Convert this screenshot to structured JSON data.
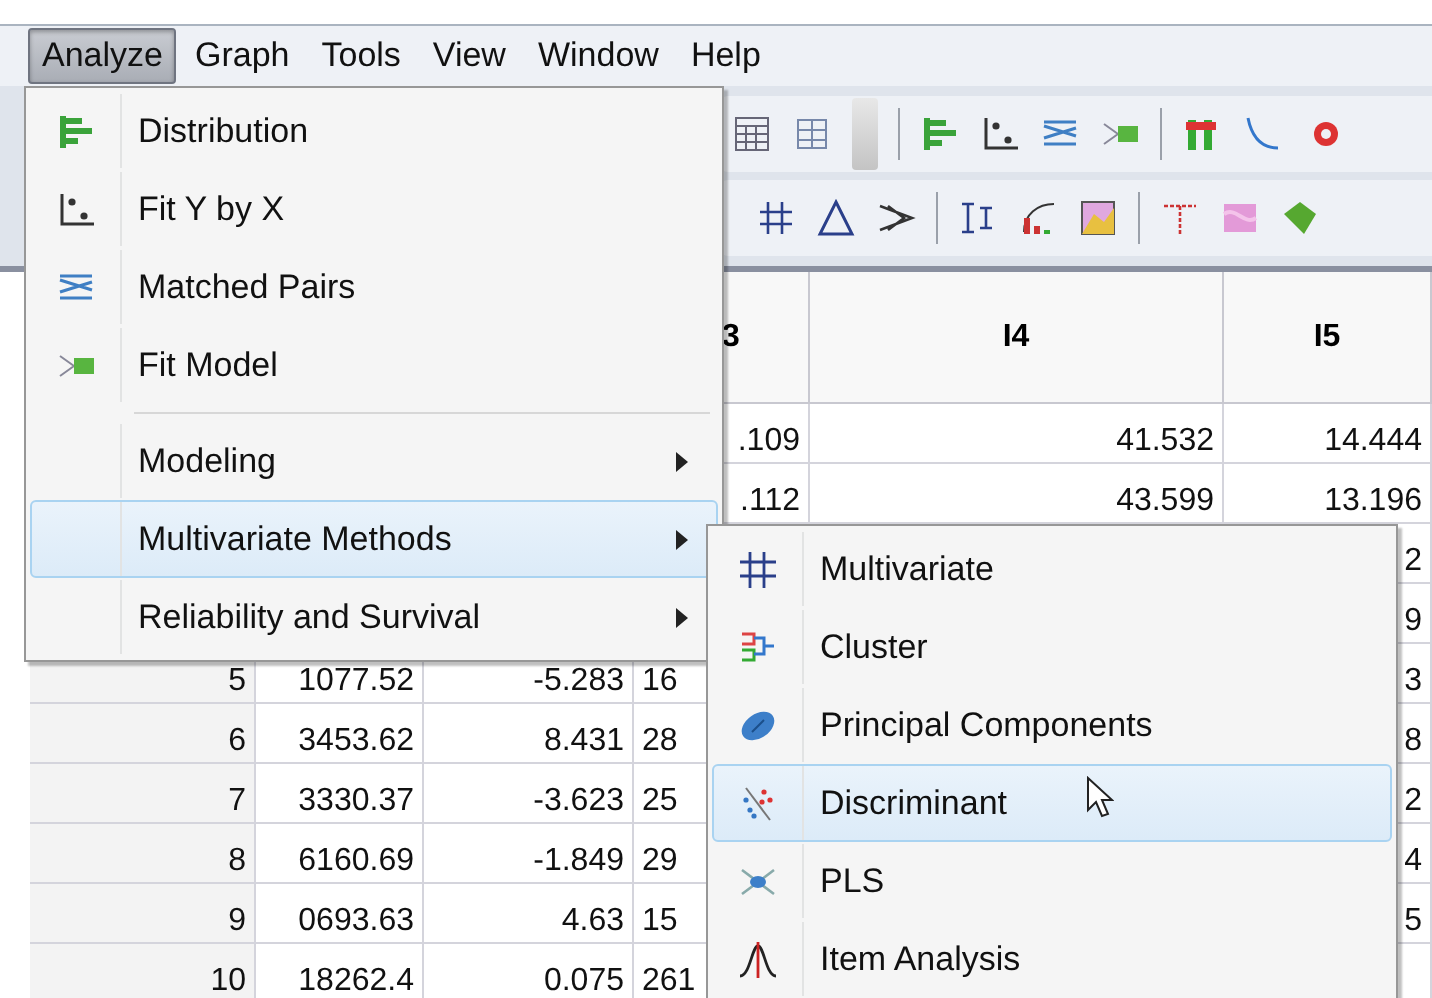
{
  "menu_bar": [
    {
      "label": "Analyze",
      "selected": true
    },
    {
      "label": "Graph",
      "selected": false
    },
    {
      "label": "Tools",
      "selected": false
    },
    {
      "label": "View",
      "selected": false
    },
    {
      "label": "Window",
      "selected": false
    },
    {
      "label": "Help",
      "selected": false
    }
  ],
  "analyze_menu": [
    {
      "kind": "command",
      "label": "Distribution",
      "selected": false
    },
    {
      "kind": "command",
      "label": "Fit Y by X",
      "selected": false
    },
    {
      "kind": "command",
      "label": "Matched Pairs",
      "selected": false
    },
    {
      "kind": "command",
      "label": "Fit Model",
      "selected": false
    },
    {
      "kind": "separator"
    },
    {
      "kind": "submenu",
      "label": "Modeling",
      "selected": false
    },
    {
      "kind": "submenu",
      "label": "Multivariate Methods",
      "selected": true
    },
    {
      "kind": "submenu",
      "label": "Reliability and Survival",
      "selected": false
    }
  ],
  "multivariate_submenu": [
    {
      "label": "Multivariate",
      "selected": false
    },
    {
      "label": "Cluster",
      "selected": false
    },
    {
      "label": "Principal Components",
      "selected": false
    },
    {
      "label": "Discriminant",
      "selected": true
    },
    {
      "label": "PLS",
      "selected": false
    },
    {
      "label": "Item Analysis",
      "selected": false
    }
  ],
  "table": {
    "columns": [
      {
        "label": "3",
        "clipped": true
      },
      {
        "label": "I4"
      },
      {
        "label": "I5"
      }
    ],
    "rows": [
      {
        "col_3": {
          "text": ".109",
          "clipped": false
        },
        "i4": "41.532",
        "i5": "14.444"
      },
      {
        "col_3": {
          "text": ".112",
          "clipped": false
        },
        "i4": "43.599",
        "i5": "13.196"
      },
      {
        "i5": "2"
      },
      {
        "i5": "9"
      },
      {
        "row_number": "5",
        "col_1": "1077.52",
        "col_2": "-5.283",
        "col_3": {
          "text": "16",
          "clipped": true
        },
        "i5": "3"
      },
      {
        "row_number": "6",
        "col_1": "3453.62",
        "col_2": "8.431",
        "col_3": {
          "text": "28",
          "clipped": true
        },
        "i5": "8"
      },
      {
        "row_number": "7",
        "col_1": "3330.37",
        "col_2": "-3.623",
        "col_3": {
          "text": "25",
          "clipped": true
        },
        "i5": "2"
      },
      {
        "row_number": "8",
        "col_1": "6160.69",
        "col_2": "-1.849",
        "col_3": {
          "text": "29",
          "clipped": true
        },
        "i5": "4"
      },
      {
        "row_number": "9",
        "col_1": "0693.63",
        "col_2": "4.63",
        "col_3": {
          "text": "15",
          "clipped": true
        },
        "i5": "5"
      },
      {
        "row_number": "10",
        "col_1": "18262.4",
        "col_2": "0.075",
        "col_3": {
          "text": "261",
          "clipped": true
        }
      }
    ]
  }
}
